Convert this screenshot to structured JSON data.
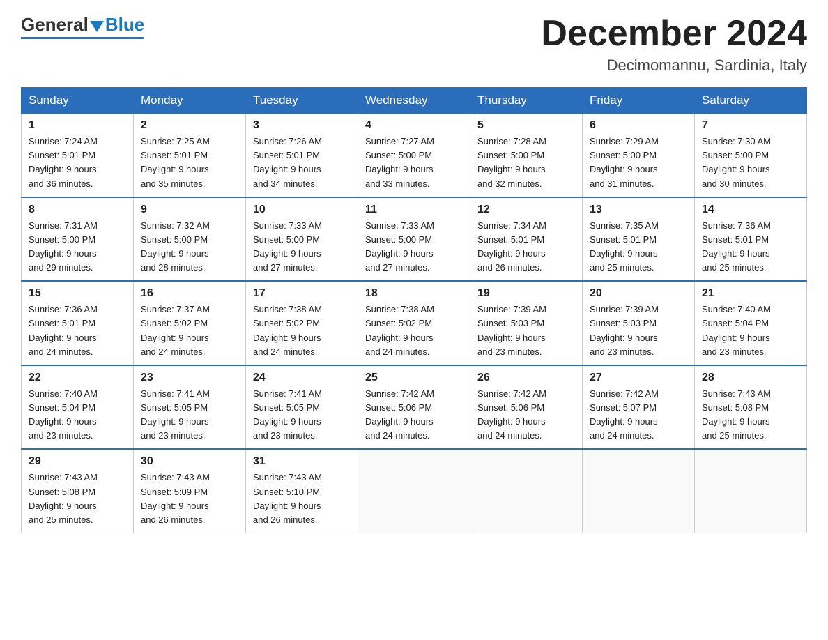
{
  "header": {
    "logo_general": "General",
    "logo_blue": "Blue",
    "month_title": "December 2024",
    "location": "Decimomannu, Sardinia, Italy"
  },
  "days_of_week": [
    "Sunday",
    "Monday",
    "Tuesday",
    "Wednesday",
    "Thursday",
    "Friday",
    "Saturday"
  ],
  "weeks": [
    [
      {
        "day": "1",
        "sunrise": "7:24 AM",
        "sunset": "5:01 PM",
        "daylight": "9 hours and 36 minutes."
      },
      {
        "day": "2",
        "sunrise": "7:25 AM",
        "sunset": "5:01 PM",
        "daylight": "9 hours and 35 minutes."
      },
      {
        "day": "3",
        "sunrise": "7:26 AM",
        "sunset": "5:01 PM",
        "daylight": "9 hours and 34 minutes."
      },
      {
        "day": "4",
        "sunrise": "7:27 AM",
        "sunset": "5:00 PM",
        "daylight": "9 hours and 33 minutes."
      },
      {
        "day": "5",
        "sunrise": "7:28 AM",
        "sunset": "5:00 PM",
        "daylight": "9 hours and 32 minutes."
      },
      {
        "day": "6",
        "sunrise": "7:29 AM",
        "sunset": "5:00 PM",
        "daylight": "9 hours and 31 minutes."
      },
      {
        "day": "7",
        "sunrise": "7:30 AM",
        "sunset": "5:00 PM",
        "daylight": "9 hours and 30 minutes."
      }
    ],
    [
      {
        "day": "8",
        "sunrise": "7:31 AM",
        "sunset": "5:00 PM",
        "daylight": "9 hours and 29 minutes."
      },
      {
        "day": "9",
        "sunrise": "7:32 AM",
        "sunset": "5:00 PM",
        "daylight": "9 hours and 28 minutes."
      },
      {
        "day": "10",
        "sunrise": "7:33 AM",
        "sunset": "5:00 PM",
        "daylight": "9 hours and 27 minutes."
      },
      {
        "day": "11",
        "sunrise": "7:33 AM",
        "sunset": "5:00 PM",
        "daylight": "9 hours and 27 minutes."
      },
      {
        "day": "12",
        "sunrise": "7:34 AM",
        "sunset": "5:01 PM",
        "daylight": "9 hours and 26 minutes."
      },
      {
        "day": "13",
        "sunrise": "7:35 AM",
        "sunset": "5:01 PM",
        "daylight": "9 hours and 25 minutes."
      },
      {
        "day": "14",
        "sunrise": "7:36 AM",
        "sunset": "5:01 PM",
        "daylight": "9 hours and 25 minutes."
      }
    ],
    [
      {
        "day": "15",
        "sunrise": "7:36 AM",
        "sunset": "5:01 PM",
        "daylight": "9 hours and 24 minutes."
      },
      {
        "day": "16",
        "sunrise": "7:37 AM",
        "sunset": "5:02 PM",
        "daylight": "9 hours and 24 minutes."
      },
      {
        "day": "17",
        "sunrise": "7:38 AM",
        "sunset": "5:02 PM",
        "daylight": "9 hours and 24 minutes."
      },
      {
        "day": "18",
        "sunrise": "7:38 AM",
        "sunset": "5:02 PM",
        "daylight": "9 hours and 24 minutes."
      },
      {
        "day": "19",
        "sunrise": "7:39 AM",
        "sunset": "5:03 PM",
        "daylight": "9 hours and 23 minutes."
      },
      {
        "day": "20",
        "sunrise": "7:39 AM",
        "sunset": "5:03 PM",
        "daylight": "9 hours and 23 minutes."
      },
      {
        "day": "21",
        "sunrise": "7:40 AM",
        "sunset": "5:04 PM",
        "daylight": "9 hours and 23 minutes."
      }
    ],
    [
      {
        "day": "22",
        "sunrise": "7:40 AM",
        "sunset": "5:04 PM",
        "daylight": "9 hours and 23 minutes."
      },
      {
        "day": "23",
        "sunrise": "7:41 AM",
        "sunset": "5:05 PM",
        "daylight": "9 hours and 23 minutes."
      },
      {
        "day": "24",
        "sunrise": "7:41 AM",
        "sunset": "5:05 PM",
        "daylight": "9 hours and 23 minutes."
      },
      {
        "day": "25",
        "sunrise": "7:42 AM",
        "sunset": "5:06 PM",
        "daylight": "9 hours and 24 minutes."
      },
      {
        "day": "26",
        "sunrise": "7:42 AM",
        "sunset": "5:06 PM",
        "daylight": "9 hours and 24 minutes."
      },
      {
        "day": "27",
        "sunrise": "7:42 AM",
        "sunset": "5:07 PM",
        "daylight": "9 hours and 24 minutes."
      },
      {
        "day": "28",
        "sunrise": "7:43 AM",
        "sunset": "5:08 PM",
        "daylight": "9 hours and 25 minutes."
      }
    ],
    [
      {
        "day": "29",
        "sunrise": "7:43 AM",
        "sunset": "5:08 PM",
        "daylight": "9 hours and 25 minutes."
      },
      {
        "day": "30",
        "sunrise": "7:43 AM",
        "sunset": "5:09 PM",
        "daylight": "9 hours and 26 minutes."
      },
      {
        "day": "31",
        "sunrise": "7:43 AM",
        "sunset": "5:10 PM",
        "daylight": "9 hours and 26 minutes."
      },
      null,
      null,
      null,
      null
    ]
  ],
  "labels": {
    "sunrise": "Sunrise:",
    "sunset": "Sunset:",
    "daylight": "Daylight:"
  }
}
